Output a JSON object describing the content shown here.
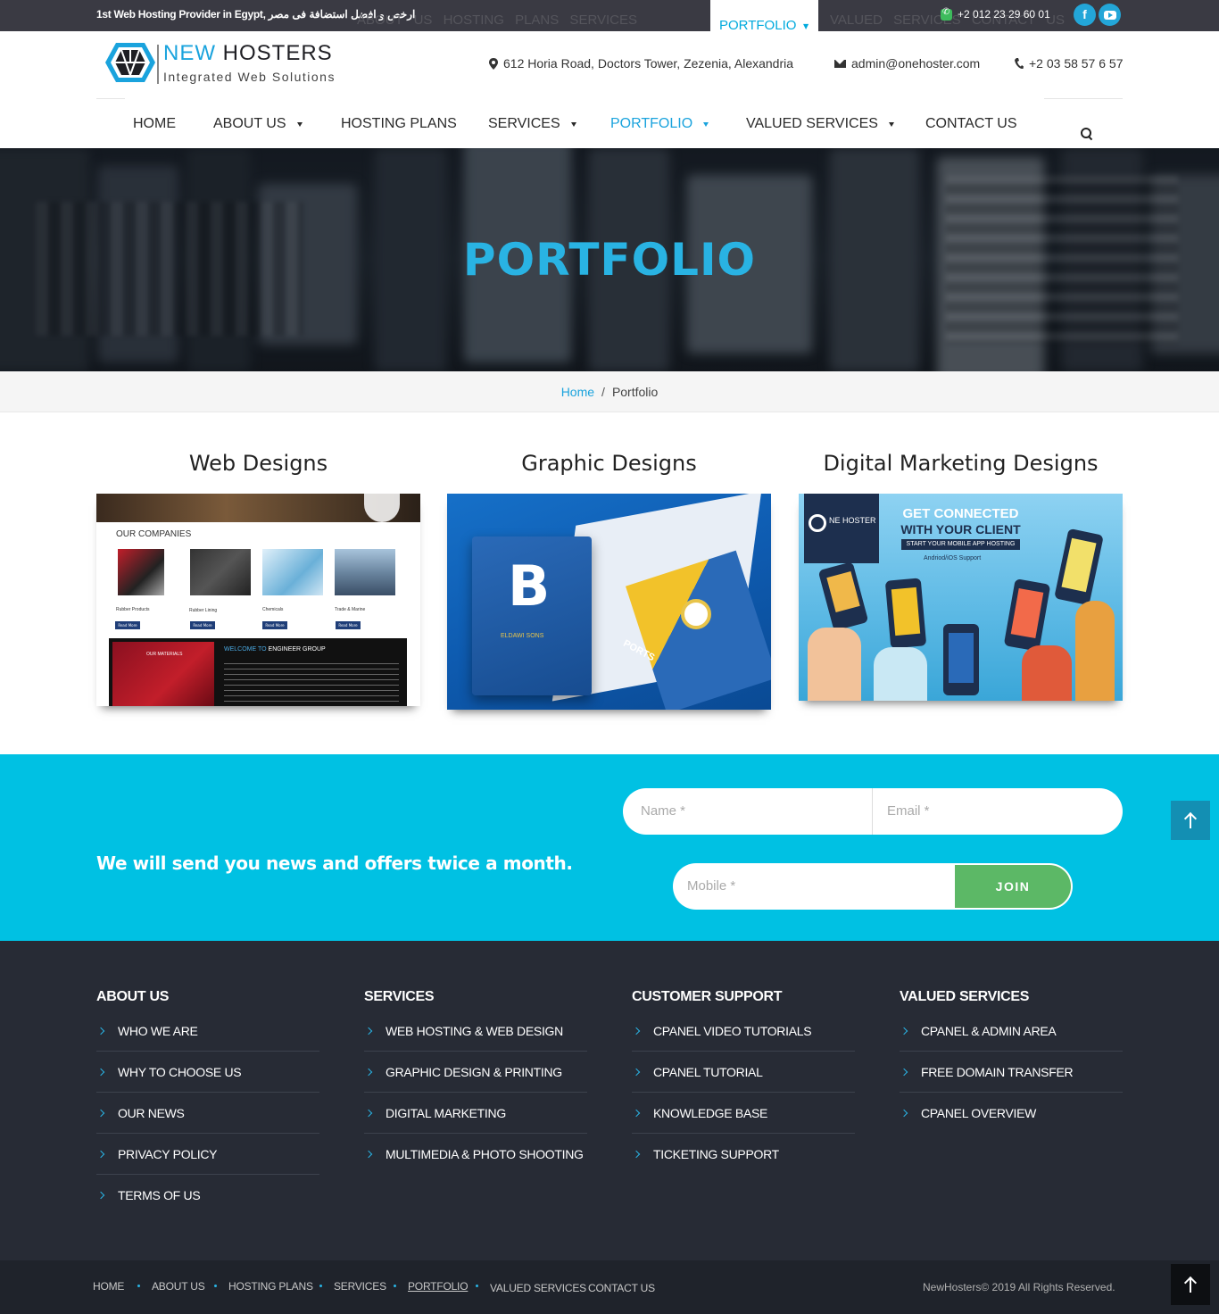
{
  "topbar": {
    "tagline": "1st Web Hosting Provider in Egypt, ارخص و افضل استضافة فى مصر",
    "ghost_nav": "ABOUT US  HOSTING PLANS  SERVICES",
    "ghost_nav_right": "VALUED SERVICES  CONTACT US",
    "sticky_active": "PORTFOLIO",
    "phone": "+2 012 23 29 60 01",
    "facebook": "f"
  },
  "header": {
    "brand_new": "NEW",
    "brand_hosters": "HOSTERS",
    "brand_tagline": "Integrated Web Solutions",
    "address": "612 Horia Road, Doctors Tower, Zezenia, Alexandria",
    "email": "admin@onehoster.com",
    "tel": "+2 03 58 57 6 57"
  },
  "nav": {
    "home": "HOME",
    "about": "ABOUT US",
    "hosting": "HOSTING PLANS",
    "services": "SERVICES",
    "portfolio": "PORTFOLIO",
    "valued": "VALUED SERVICES",
    "contact": "CONTACT US"
  },
  "hero": {
    "title": "PORTFOLIO"
  },
  "breadcrumb": {
    "home": "Home",
    "sep": "/",
    "current": "Portfolio"
  },
  "portfolio": {
    "web": {
      "title": "Web Designs",
      "heading": "OUR COMPANIES",
      "items": [
        "Rubber Products",
        "Rubber Lining",
        "Chemicals",
        "Trade & Marine"
      ],
      "btn": "Read More",
      "materials": "OUR MATERIALS",
      "welcome_prefix": "WELCOME TO",
      "welcome_name": "ENGINEER GROUP"
    },
    "graphic": {
      "title": "Graphic Designs",
      "brand": "ELDAWI SONS",
      "ports": "PORTS"
    },
    "digital": {
      "title": "Digital Marketing Designs",
      "logo": "NE HOSTER",
      "line1": "GET CONNECTED",
      "line2": "WITH YOUR CLIENT",
      "line3": "START YOUR MOBILE APP HOSTING",
      "line4": "Andriod/iOS Support"
    }
  },
  "newsletter": {
    "text": "We will send you news and offers twice a month.",
    "name_ph": "Name *",
    "email_ph": "Email *",
    "mobile_ph": "Mobile *",
    "join": "JOIN"
  },
  "footer": {
    "about": {
      "title": "ABOUT US",
      "items": [
        "WHO WE ARE",
        "WHY TO CHOOSE US",
        "OUR NEWS",
        "PRIVACY POLICY",
        "TERMS OF US"
      ]
    },
    "services": {
      "title": "SERVICES",
      "items": [
        "WEB HOSTING & WEB DESIGN",
        "GRAPHIC DESIGN & PRINTING",
        "DIGITAL MARKETING",
        "MULTIMEDIA & PHOTO SHOOTING"
      ]
    },
    "support": {
      "title": "CUSTOMER SUPPORT",
      "items": [
        "CPANEL VIDEO TUTORIALS",
        "CPANEL TUTORIAL",
        "KNOWLEDGE BASE",
        "TICKETING SUPPORT"
      ]
    },
    "valued": {
      "title": "VALUED SERVICES",
      "items": [
        "CPANEL & ADMIN AREA",
        "FREE DOMAIN TRANSFER",
        "CPANEL OVERVIEW"
      ]
    }
  },
  "bottom": {
    "links": [
      "HOME",
      "ABOUT US",
      "HOSTING PLANS",
      "SERVICES",
      "PORTFOLIO",
      "VALUED SERVICES",
      "CONTACT US"
    ],
    "copyright": "NewHosters© 2019 All Rights Reserved."
  },
  "colors": {
    "accent": "#1aa3dd",
    "newsletter_bg": "#00c1e3",
    "join_green": "#5cb866",
    "footer_bg": "#272b35",
    "topbar_bg": "#3a3a43"
  }
}
